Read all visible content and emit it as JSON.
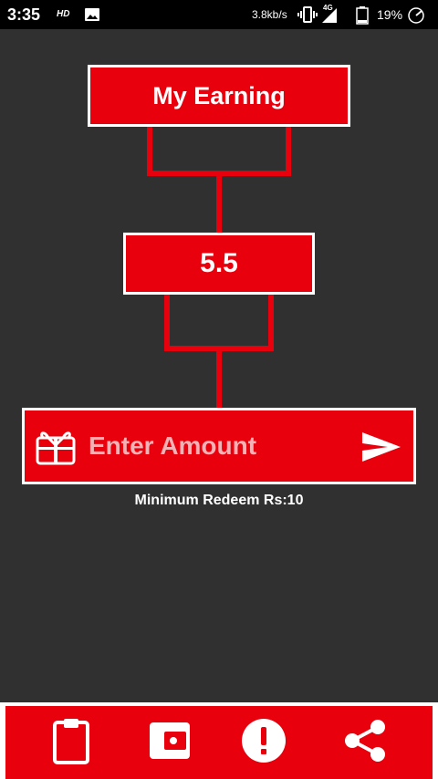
{
  "status_bar": {
    "time": "3:35",
    "hd": "HD",
    "speed": "3.8kb/s",
    "network": "4G",
    "battery": "19%"
  },
  "earning": {
    "title": "My Earning",
    "value": "5.5"
  },
  "redeem": {
    "placeholder": "Enter Amount",
    "min_text": "Minimum Redeem Rs:10"
  },
  "bottom_nav": {
    "icons": [
      "clipboard-icon",
      "wallet-icon",
      "alert-icon",
      "share-icon"
    ]
  },
  "colors": {
    "accent": "#e8000d",
    "background": "#303030"
  }
}
